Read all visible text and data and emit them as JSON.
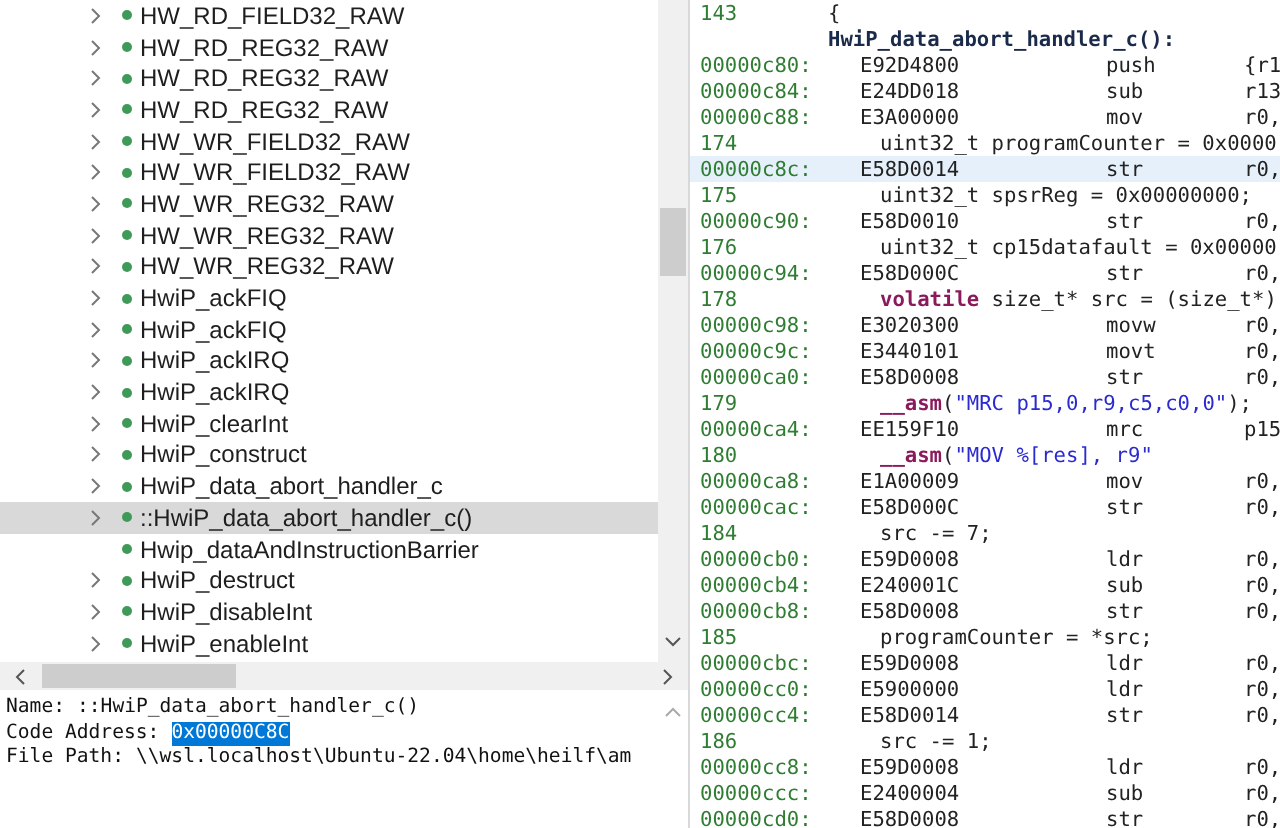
{
  "symbol_tree": {
    "items": [
      {
        "label": "HW_RD_FIELD32_RAW",
        "expandable": true,
        "selected": false
      },
      {
        "label": "HW_RD_REG32_RAW",
        "expandable": true,
        "selected": false
      },
      {
        "label": "HW_RD_REG32_RAW",
        "expandable": true,
        "selected": false
      },
      {
        "label": "HW_RD_REG32_RAW",
        "expandable": true,
        "selected": false
      },
      {
        "label": "HW_WR_FIELD32_RAW",
        "expandable": true,
        "selected": false
      },
      {
        "label": "HW_WR_FIELD32_RAW",
        "expandable": true,
        "selected": false
      },
      {
        "label": "HW_WR_REG32_RAW",
        "expandable": true,
        "selected": false
      },
      {
        "label": "HW_WR_REG32_RAW",
        "expandable": true,
        "selected": false
      },
      {
        "label": "HW_WR_REG32_RAW",
        "expandable": true,
        "selected": false
      },
      {
        "label": "HwiP_ackFIQ",
        "expandable": true,
        "selected": false
      },
      {
        "label": "HwiP_ackFIQ",
        "expandable": true,
        "selected": false
      },
      {
        "label": "HwiP_ackIRQ",
        "expandable": true,
        "selected": false
      },
      {
        "label": "HwiP_ackIRQ",
        "expandable": true,
        "selected": false
      },
      {
        "label": "HwiP_clearInt",
        "expandable": true,
        "selected": false
      },
      {
        "label": "HwiP_construct",
        "expandable": true,
        "selected": false
      },
      {
        "label": "HwiP_data_abort_handler_c",
        "expandable": true,
        "selected": false
      },
      {
        "label": "::HwiP_data_abort_handler_c()",
        "expandable": true,
        "selected": true
      },
      {
        "label": "Hwip_dataAndInstructionBarrier",
        "expandable": false,
        "selected": false
      },
      {
        "label": "HwiP_destruct",
        "expandable": true,
        "selected": false
      },
      {
        "label": "HwiP_disableInt",
        "expandable": true,
        "selected": false
      },
      {
        "label": "HwiP_enableInt",
        "expandable": true,
        "selected": false
      }
    ]
  },
  "details": {
    "name_label": "Name:",
    "name": "::HwiP_data_abort_handler_c()",
    "address_label": "Code Address:",
    "address": "0x00000C8C",
    "address_selected": true,
    "path_label": "File Path:",
    "path": "\\\\wsl.localhost\\Ubuntu-22.04\\home\\heilf\\am"
  },
  "disassembly": {
    "rows": [
      {
        "kind": "source",
        "line": "143",
        "code": [
          {
            "kind": "plain",
            "text": "{"
          }
        ],
        "indent": false
      },
      {
        "kind": "label",
        "text": "HwiP_data_abort_handler_c():"
      },
      {
        "kind": "instr",
        "address": "00000c80:",
        "opcode": "E92D4800",
        "mnemonic": "push",
        "operand": "{r1",
        "selected": false
      },
      {
        "kind": "instr",
        "address": "00000c84:",
        "opcode": "E24DD018",
        "mnemonic": "sub",
        "operand": "r13",
        "selected": false
      },
      {
        "kind": "instr",
        "address": "00000c88:",
        "opcode": "E3A00000",
        "mnemonic": "mov",
        "operand": "r0,",
        "selected": false
      },
      {
        "kind": "source",
        "line": "174",
        "code": [
          {
            "kind": "plain",
            "text": "uint32_t programCounter = 0x0000"
          }
        ],
        "indent": true
      },
      {
        "kind": "instr",
        "address": "00000c8c:",
        "opcode": "E58D0014",
        "mnemonic": "str",
        "operand": "r0,",
        "selected": true
      },
      {
        "kind": "source",
        "line": "175",
        "code": [
          {
            "kind": "plain",
            "text": "uint32_t spsrReg = 0x00000000;"
          }
        ],
        "indent": true
      },
      {
        "kind": "instr",
        "address": "00000c90:",
        "opcode": "E58D0010",
        "mnemonic": "str",
        "operand": "r0,",
        "selected": false
      },
      {
        "kind": "source",
        "line": "176",
        "code": [
          {
            "kind": "plain",
            "text": "uint32_t cp15datafault = 0x00000"
          }
        ],
        "indent": true
      },
      {
        "kind": "instr",
        "address": "00000c94:",
        "opcode": "E58D000C",
        "mnemonic": "str",
        "operand": "r0,",
        "selected": false
      },
      {
        "kind": "source",
        "line": "178",
        "code": [
          {
            "kind": "keyword",
            "text": "volatile"
          },
          {
            "kind": "plain",
            "text": " size_t* src = (size_t*)"
          }
        ],
        "indent": true
      },
      {
        "kind": "instr",
        "address": "00000c98:",
        "opcode": "E3020300",
        "mnemonic": "movw",
        "operand": "r0,",
        "selected": false
      },
      {
        "kind": "instr",
        "address": "00000c9c:",
        "opcode": "E3440101",
        "mnemonic": "movt",
        "operand": "r0,",
        "selected": false
      },
      {
        "kind": "instr",
        "address": "00000ca0:",
        "opcode": "E58D0008",
        "mnemonic": "str",
        "operand": "r0,",
        "selected": false
      },
      {
        "kind": "source",
        "line": "179",
        "code": [
          {
            "kind": "keyword",
            "text": "__asm"
          },
          {
            "kind": "plain",
            "text": "("
          },
          {
            "kind": "string",
            "text": "\"MRC p15,0,r9,c5,c0,0\""
          },
          {
            "kind": "plain",
            "text": ");"
          }
        ],
        "indent": true
      },
      {
        "kind": "instr",
        "address": "00000ca4:",
        "opcode": "EE159F10",
        "mnemonic": "mrc",
        "operand": "p15",
        "selected": false
      },
      {
        "kind": "source",
        "line": "180",
        "code": [
          {
            "kind": "keyword",
            "text": "__asm"
          },
          {
            "kind": "plain",
            "text": "("
          },
          {
            "kind": "string",
            "text": "\"MOV %[res], r9\""
          }
        ],
        "indent": true
      },
      {
        "kind": "instr",
        "address": "00000ca8:",
        "opcode": "E1A00009",
        "mnemonic": "mov",
        "operand": "r0,",
        "selected": false
      },
      {
        "kind": "instr",
        "address": "00000cac:",
        "opcode": "E58D000C",
        "mnemonic": "str",
        "operand": "r0,",
        "selected": false
      },
      {
        "kind": "source",
        "line": "184",
        "code": [
          {
            "kind": "plain",
            "text": "src -= 7;"
          }
        ],
        "indent": true
      },
      {
        "kind": "instr",
        "address": "00000cb0:",
        "opcode": "E59D0008",
        "mnemonic": "ldr",
        "operand": "r0,",
        "selected": false
      },
      {
        "kind": "instr",
        "address": "00000cb4:",
        "opcode": "E240001C",
        "mnemonic": "sub",
        "operand": "r0,",
        "selected": false
      },
      {
        "kind": "instr",
        "address": "00000cb8:",
        "opcode": "E58D0008",
        "mnemonic": "str",
        "operand": "r0,",
        "selected": false
      },
      {
        "kind": "source",
        "line": "185",
        "code": [
          {
            "kind": "plain",
            "text": "programCounter = *src;"
          }
        ],
        "indent": true
      },
      {
        "kind": "instr",
        "address": "00000cbc:",
        "opcode": "E59D0008",
        "mnemonic": "ldr",
        "operand": "r0,",
        "selected": false
      },
      {
        "kind": "instr",
        "address": "00000cc0:",
        "opcode": "E5900000",
        "mnemonic": "ldr",
        "operand": "r0,",
        "selected": false
      },
      {
        "kind": "instr",
        "address": "00000cc4:",
        "opcode": "E58D0014",
        "mnemonic": "str",
        "operand": "r0,",
        "selected": false
      },
      {
        "kind": "source",
        "line": "186",
        "code": [
          {
            "kind": "plain",
            "text": "src -= 1;"
          }
        ],
        "indent": true
      },
      {
        "kind": "instr",
        "address": "00000cc8:",
        "opcode": "E59D0008",
        "mnemonic": "ldr",
        "operand": "r0,",
        "selected": false
      },
      {
        "kind": "instr",
        "address": "00000ccc:",
        "opcode": "E2400004",
        "mnemonic": "sub",
        "operand": "r0,",
        "selected": false
      },
      {
        "kind": "instr",
        "address": "00000cd0:",
        "opcode": "E58D0008",
        "mnemonic": "str",
        "operand": "r0,",
        "selected": false
      }
    ]
  }
}
